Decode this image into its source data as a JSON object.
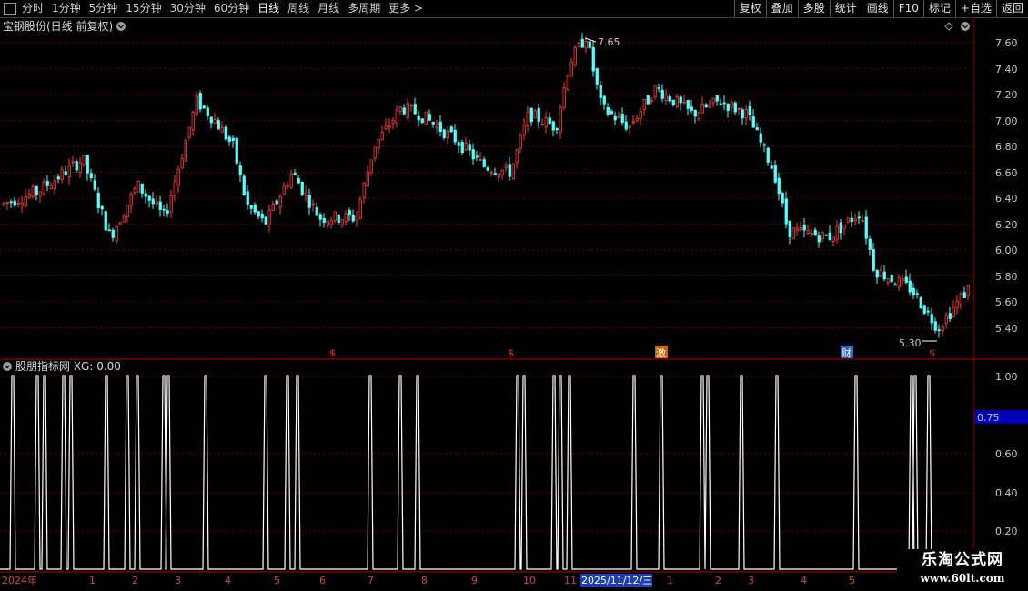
{
  "toolbar": {
    "periods": [
      "分时",
      "1分钟",
      "5分钟",
      "15分钟",
      "30分钟",
      "60分钟",
      "日线",
      "周线",
      "月线",
      "多周期",
      "更多 >"
    ],
    "active_period": "日线",
    "actions": [
      "复权",
      "叠加",
      "多股",
      "统计",
      "画线",
      "F10",
      "标记",
      "+自选",
      "返回"
    ]
  },
  "main_panel": {
    "title": "宝钢股份(日线 前复权)",
    "high_label": "7.65",
    "low_label": "5.30",
    "price_ticks": [
      "7.60",
      "7.40",
      "7.20",
      "7.00",
      "6.80",
      "6.60",
      "6.40",
      "6.20",
      "6.00",
      "5.80",
      "5.60",
      "5.40"
    ],
    "event_markers": [
      "$",
      "$",
      "激",
      "财",
      "$"
    ]
  },
  "indicator_panel": {
    "title": "股朋指标网 XG: 0.00",
    "ticks": [
      "1.00",
      "0.60",
      "0.40",
      "0.20"
    ],
    "cursor_value": "0.75"
  },
  "date_axis": {
    "labels": [
      "2024年",
      "1",
      "2",
      "3",
      "4",
      "5",
      "6",
      "7",
      "8",
      "9",
      "10",
      "11",
      "2025/11/12/三",
      "1",
      "2",
      "3",
      "4",
      "5"
    ]
  },
  "watermark": {
    "title": "乐淘公式网",
    "url": "www.60lt.com"
  },
  "colors": {
    "up": "#ff3c3c",
    "down": "#54fcfc",
    "grid": "#6b0000",
    "border": "#b00000",
    "line": "#ffffff"
  },
  "chart_data": {
    "type": "candlestick",
    "price_range": [
      5.3,
      7.65
    ],
    "y_axis_range": [
      5.3,
      7.7
    ],
    "indicator_range": [
      0,
      1.05
    ],
    "indicator_signal_count": 45,
    "indicator_value": 0.0
  }
}
